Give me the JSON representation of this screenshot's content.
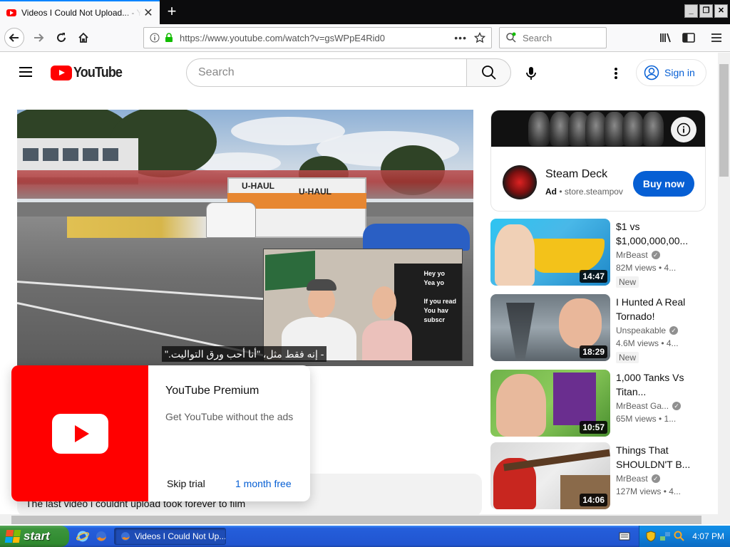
{
  "browser": {
    "tab_title": "Videos I Could Not Upload... - YouTube",
    "new_tab_glyph": "+",
    "url": "https://www.youtube.com/watch?v=gsWPpE4Rid0",
    "url_more": "•••",
    "search_placeholder": "Search",
    "window_buttons": [
      "_",
      "❐",
      "✕"
    ]
  },
  "youtube": {
    "logo_text": "YouTube",
    "search_placeholder": "Search",
    "signin_label": "Sign in"
  },
  "video": {
    "subtitle": "- إنه فقط مثل، \"أنا أحب ورق التواليت.\"",
    "truck_logo": "U-HAUL",
    "inset_board_text": [
      "Hey yo",
      "Yea yo",
      "",
      "If you read",
      "You hav",
      "subscr"
    ],
    "description": "The last video i couldnt upload took forever to film"
  },
  "premium_popup": {
    "title": "YouTube Premium",
    "subtitle": "Get YouTube without the ads",
    "skip_label": "Skip trial",
    "free_label": "1 month free"
  },
  "ad": {
    "name": "Steam Deck",
    "label": "Ad",
    "separator": "•",
    "domain": "store.steampov",
    "cta": "Buy now"
  },
  "recommendations": [
    {
      "title": "$1 vs $1,000,000,00...",
      "channel": "MrBeast",
      "verified": true,
      "stats": "82M views • 4...",
      "badge": "New",
      "duration": "14:47"
    },
    {
      "title": "I Hunted A Real Tornado!",
      "channel": "Unspeakable",
      "verified": true,
      "stats": "4.6M views • 4...",
      "badge": "New",
      "duration": "18:29"
    },
    {
      "title": "1,000 Tanks Vs Titan...",
      "channel": "MrBeast Ga...",
      "verified": true,
      "stats": "65M views • 1...",
      "badge": "",
      "duration": "10:57"
    },
    {
      "title": "Things That SHOULDN'T B...",
      "channel": "MrBeast",
      "verified": true,
      "stats": "127M views • 4...",
      "badge": "",
      "duration": "14:06"
    }
  ],
  "taskbar": {
    "start_label": "start",
    "task_label": "Videos I Could Not Up...",
    "time": "4:07 PM"
  },
  "colors": {
    "youtube_red": "#ff0000",
    "link_blue": "#065fd4",
    "firefox_accent": "#0a84ff",
    "xp_blue": "#245edb",
    "xp_start_green": "#3c943c"
  }
}
